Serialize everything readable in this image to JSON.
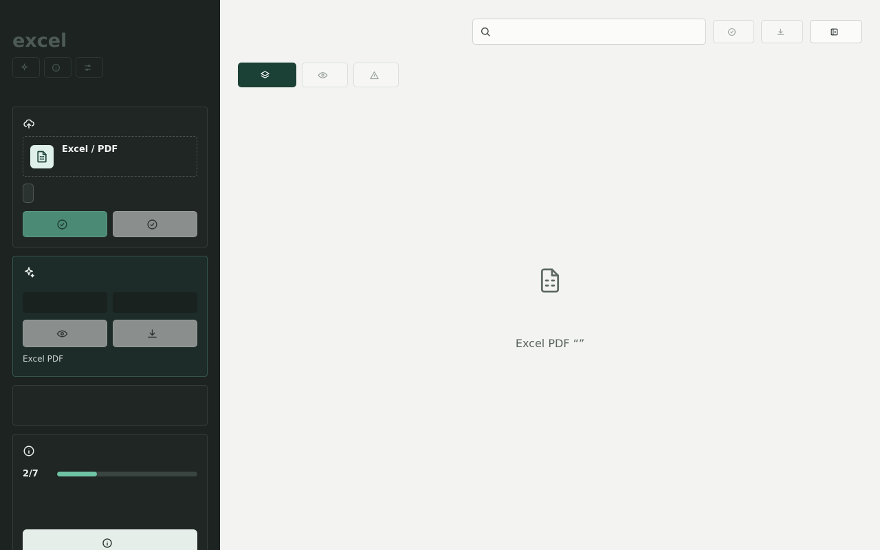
{
  "sidebar": {
    "brand_small": "",
    "brand_title": "excel",
    "top_pills": [
      {
        "icon": "sparkle-icon",
        "label": ""
      },
      {
        "icon": "info-icon",
        "label": ""
      },
      {
        "icon": "sliders-icon",
        "label": ""
      }
    ],
    "note": "",
    "upload": {
      "title": "",
      "dropzone_title": " Excel / PDF",
      "dropzone_sub": "",
      "tag": "",
      "btn_primary": "",
      "btn_secondary": ""
    },
    "generate": {
      "title": "",
      "field1_prefix": "",
      "field1_value": "",
      "field2_prefix": "",
      "field2_value": "",
      "btn_preview": "",
      "btn_download": "",
      "note": " Excel  PDF"
    },
    "toggle": {
      "title": "",
      "sub": "",
      "state": ""
    },
    "guide": {
      "title": "",
      "count": "2/7",
      "progress_fraction": 0.2857,
      "step_title": "",
      "step_desc": "",
      "button": ""
    }
  },
  "main": {
    "breadcrumb": "",
    "title": "",
    "search_placeholder": "",
    "toolbar": {
      "btn1": "",
      "btn2": "",
      "btn3": ""
    },
    "tabs": [
      {
        "icon": "layers-icon",
        "label": "",
        "active": true
      },
      {
        "icon": "eye-icon",
        "label": "",
        "active": false
      },
      {
        "icon": "warning-icon",
        "label": "",
        "active": false
      }
    ],
    "empty": {
      "title": "",
      "desc": " Excel  PDF “”"
    }
  },
  "colors": {
    "sidebar_bg": "#1c2321",
    "accent_dark": "#1b4036",
    "accent_green": "#4b8a74",
    "progress": "#6fc4a4"
  }
}
